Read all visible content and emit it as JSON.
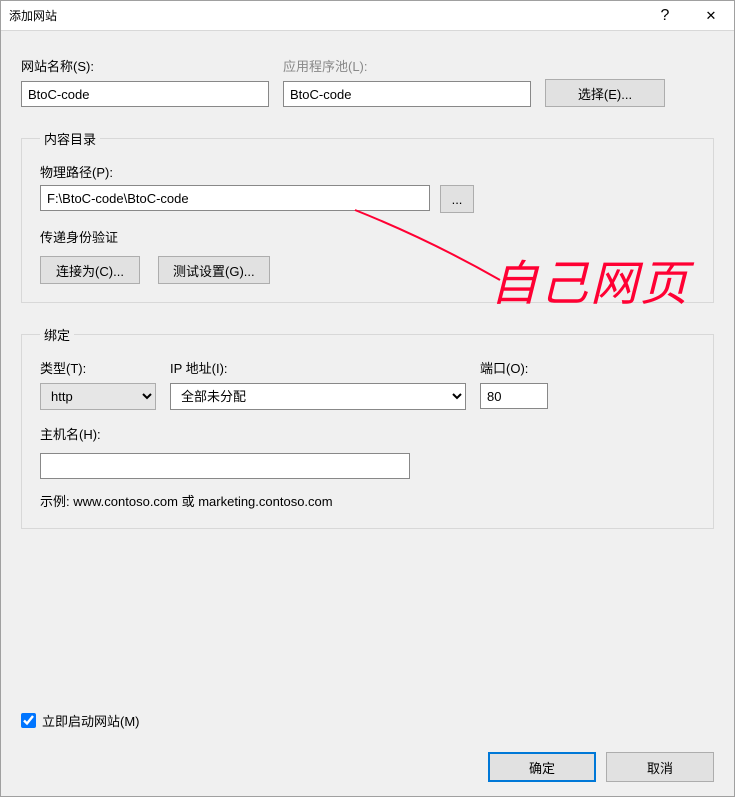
{
  "window": {
    "title": "添加网站",
    "help": "?",
    "close": "✕"
  },
  "sitename": {
    "label": "网站名称(S):",
    "value": "BtoC-code"
  },
  "apppool": {
    "label": "应用程序池(L):",
    "value": "BtoC-code",
    "select_btn": "选择(E)..."
  },
  "content_dir": {
    "legend": "内容目录",
    "path_label": "物理路径(P):",
    "path_value": "F:\\BtoC-code\\BtoC-code",
    "browse": "...",
    "auth_label": "传递身份验证",
    "connect_as": "连接为(C)...",
    "test_settings": "测试设置(G)..."
  },
  "binding": {
    "legend": "绑定",
    "type_label": "类型(T):",
    "type_value": "http",
    "ip_label": "IP 地址(I):",
    "ip_value": "全部未分配",
    "port_label": "端口(O):",
    "port_value": "80",
    "host_label": "主机名(H):",
    "host_value": "",
    "example": "示例: www.contoso.com 或 marketing.contoso.com"
  },
  "start_now": {
    "label": "立即启动网站(M)",
    "checked": true
  },
  "buttons": {
    "ok": "确定",
    "cancel": "取消"
  },
  "annotation": {
    "text": "自己网页"
  }
}
